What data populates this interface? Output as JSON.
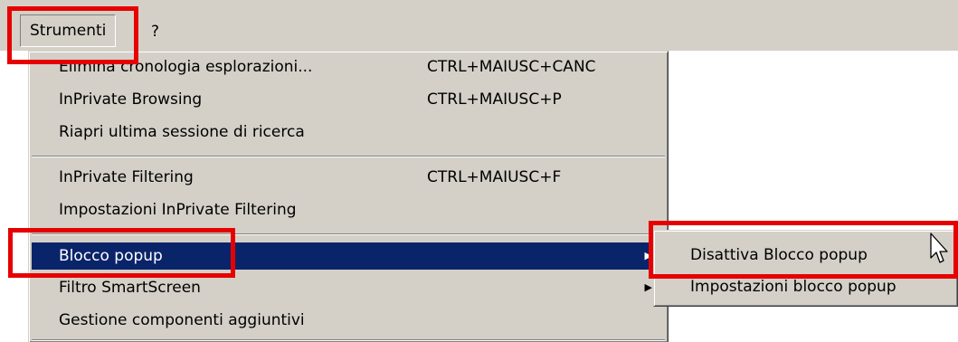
{
  "menubar": {
    "items": [
      {
        "label": "Strumenti"
      },
      {
        "label": "?"
      }
    ]
  },
  "tools_menu": {
    "items": [
      {
        "label": "Elimina cronologia esplorazioni...",
        "shortcut": "CTRL+MAIUSC+CANC"
      },
      {
        "label": "InPrivate Browsing",
        "shortcut": "CTRL+MAIUSC+P"
      },
      {
        "label": "Riapri ultima sessione di ricerca",
        "shortcut": ""
      },
      {
        "label": "InPrivate Filtering",
        "shortcut": "CTRL+MAIUSC+F"
      },
      {
        "label": "Impostazioni InPrivate Filtering",
        "shortcut": ""
      },
      {
        "label": "Blocco popup",
        "shortcut": "",
        "has_submenu": true,
        "highlighted": true
      },
      {
        "label": "Filtro SmartScreen",
        "shortcut": "",
        "has_submenu": true
      },
      {
        "label": "Gestione componenti aggiuntivi",
        "shortcut": ""
      }
    ]
  },
  "submenu": {
    "items": [
      {
        "label": "Disattiva Blocco popup"
      },
      {
        "label": "Impostazioni blocco popup"
      }
    ]
  },
  "icons": {
    "submenu_arrow": "triangle-right-icon",
    "cursor": "arrow-cursor-icon"
  },
  "colors": {
    "menu_bg": "#d4d0c8",
    "highlight": "#0a246a",
    "annotation": "#e60000"
  }
}
